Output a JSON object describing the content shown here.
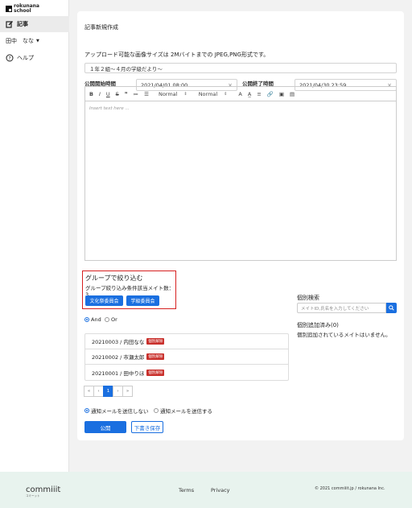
{
  "brand": {
    "line1": "rokunana",
    "line2": "school"
  },
  "sidebar": {
    "items": [
      {
        "label": "記事",
        "icon": "edit-icon",
        "active": true
      },
      {
        "label": "田中　なな",
        "icon": "",
        "active": false
      },
      {
        "label": "ヘルプ",
        "icon": "help-circle-icon",
        "active": false
      }
    ]
  },
  "form": {
    "title": "記事新規作成",
    "upload_note": "アップロード可能な画像サイズは 2Mバイトまでの JPEG,PNG形式です。",
    "subject_value": "１年２組〜４月の学級だより〜",
    "start_label": "公開開始時間",
    "start_value": "2021/04/01 08:00",
    "end_label": "公開終了時間",
    "end_value": "2021/04/30 23:59",
    "editor": {
      "toolbar": [
        "B",
        "I",
        "U",
        "S",
        "❞",
        "≔",
        "☰",
        "Normal",
        "Normal",
        "A",
        "A̲",
        "≡",
        "🔗",
        "▣",
        "▤"
      ],
      "heading_select": "Normal",
      "size_select": "Normal",
      "placeholder": "Insert text here ..."
    }
  },
  "group_filter": {
    "title": "グループで絞り込む",
    "count_text": "グループ絞り込み条件該当メイト数：3",
    "groups": [
      "文化祭委員会",
      "学級委員会"
    ]
  },
  "logic": {
    "and_label": "And",
    "or_label": "Or",
    "selected": "And"
  },
  "members": [
    {
      "text": "20210003 / 内田なな",
      "badge": "個別解除"
    },
    {
      "text": "20210002 / 市瀬太郎",
      "badge": "個別解除"
    },
    {
      "text": "20210001 / 田中りほ",
      "badge": "個別解除"
    }
  ],
  "pagination": {
    "first": "«",
    "prev": "‹",
    "current": "1",
    "next": "›",
    "last": "»"
  },
  "individual": {
    "search_title": "個別検索",
    "search_placeholder": "メイトID,氏名を入力してください",
    "added_title": "個別追加済み(0)",
    "added_empty": "個別追加されているメイトはいません。"
  },
  "notify": {
    "no_send": "通知メールを送信しない",
    "send": "通知メールを送信する",
    "selected": "no_send"
  },
  "actions": {
    "publish": "公開",
    "draft": "下書き保存"
  },
  "footer": {
    "logo": "commiiit",
    "logo_sub": "コミーット",
    "terms": "Terms",
    "privacy": "Privacy",
    "copyright": "© 2021 commiiit.jp / rokunana Inc."
  },
  "colors": {
    "primary": "#1a6fe0",
    "danger": "#c9302c",
    "highlight": "#d62020",
    "footer_bg": "#e8f3ee"
  }
}
